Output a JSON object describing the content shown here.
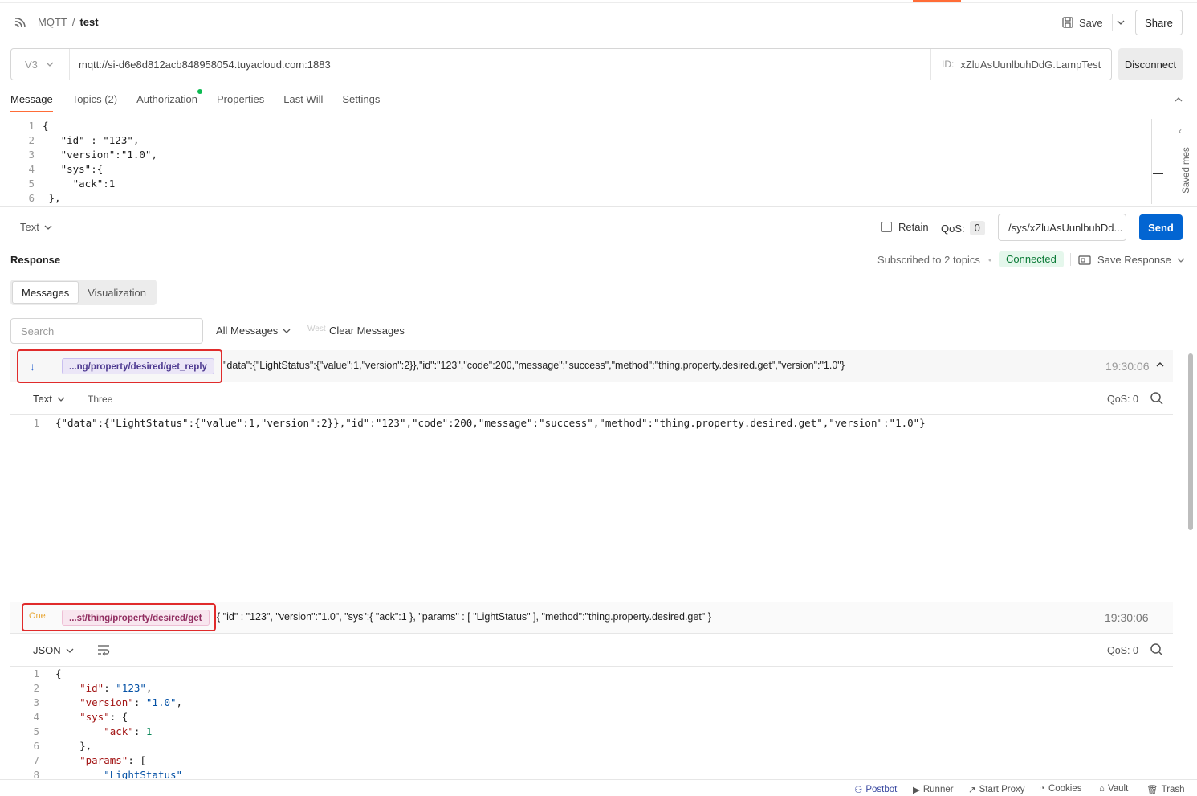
{
  "header": {
    "protocol": "MQTT",
    "separator": "/",
    "request_name": "test",
    "save_label": "Save",
    "share_label": "Share"
  },
  "urlbar": {
    "version": "V3",
    "url": "mqtt://si-d6e8d812acb848958054.tuyacloud.com:1883",
    "id_label": "ID:",
    "client_id": "xZluAsUunlbuhDdG.LampTest",
    "disconnect_label": "Disconnect"
  },
  "request_tabs": [
    {
      "label": "Message",
      "active": true
    },
    {
      "label": "Topics (2)"
    },
    {
      "label": "Authorization",
      "dot": true
    },
    {
      "label": "Properties"
    },
    {
      "label": "Last Will"
    },
    {
      "label": "Settings"
    }
  ],
  "message_editor": {
    "line_numbers": [
      "1",
      "2",
      "3",
      "4",
      "5",
      "6"
    ],
    "lines": [
      "{",
      "   \"id\" : \"123\",",
      "   \"version\":\"1.0\",",
      "   \"sys\":{",
      "     \"ack\":1",
      " },"
    ],
    "saved_messages_label": "Saved mes"
  },
  "send_row": {
    "format": "Text",
    "retain_label": "Retain",
    "qos_label": "QoS:",
    "qos_value": "0",
    "topic": "/sys/xZluAsUunlbuhDd...",
    "send_label": "Send"
  },
  "response": {
    "title": "Response",
    "subscribed": "Subscribed to 2 topics",
    "status": "Connected",
    "save_response": "Save Response",
    "tabs": [
      "Messages",
      "Visualization"
    ],
    "search_placeholder": "Search",
    "filter": "All Messages",
    "faint_label": "West",
    "clear_label": "Clear Messages"
  },
  "messages": [
    {
      "direction": "incoming",
      "topic": "...ng/property/desired/get_reply",
      "payload": "\"data\":{\"LightStatus\":{\"value\":1,\"version\":2}},\"id\":\"123\",\"code\":200,\"message\":\"success\",\"method\":\"thing.property.desired.get\",\"version\":\"1.0\"}",
      "time": "19:30:06",
      "format": "Text",
      "extra": "Three",
      "qos": "QoS: 0",
      "body_line_numbers": [
        "1"
      ],
      "body_lines": [
        "{\"data\":{\"LightStatus\":{\"value\":1,\"version\":2}},\"id\":\"123\",\"code\":200,\"message\":\"success\",\"method\":\"thing.property.desired.get\",\"version\":\"1.0\"}"
      ]
    },
    {
      "direction": "outgoing",
      "direction_label": "One",
      "topic": "...st/thing/property/desired/get",
      "payload": "{ \"id\" : \"123\", \"version\":\"1.0\", \"sys\":{ \"ack\":1 }, \"params\" : [ \"LightStatus\" ], \"method\":\"thing.property.desired.get\" }",
      "time": "19:30:06",
      "format": "JSON",
      "qos": "QoS: 0",
      "body_line_numbers": [
        "1",
        "2",
        "3",
        "4",
        "5",
        "6",
        "7",
        "8"
      ]
    }
  ],
  "statusbar": [
    "Postbot",
    "Runner",
    "Start Proxy",
    "Cookies",
    "Vault",
    "Trash"
  ],
  "colors": {
    "accent": "#ff6c37",
    "send": "#0265d2",
    "connected_bg": "#e5f7ec",
    "highlight_box": "#e02b2b"
  }
}
